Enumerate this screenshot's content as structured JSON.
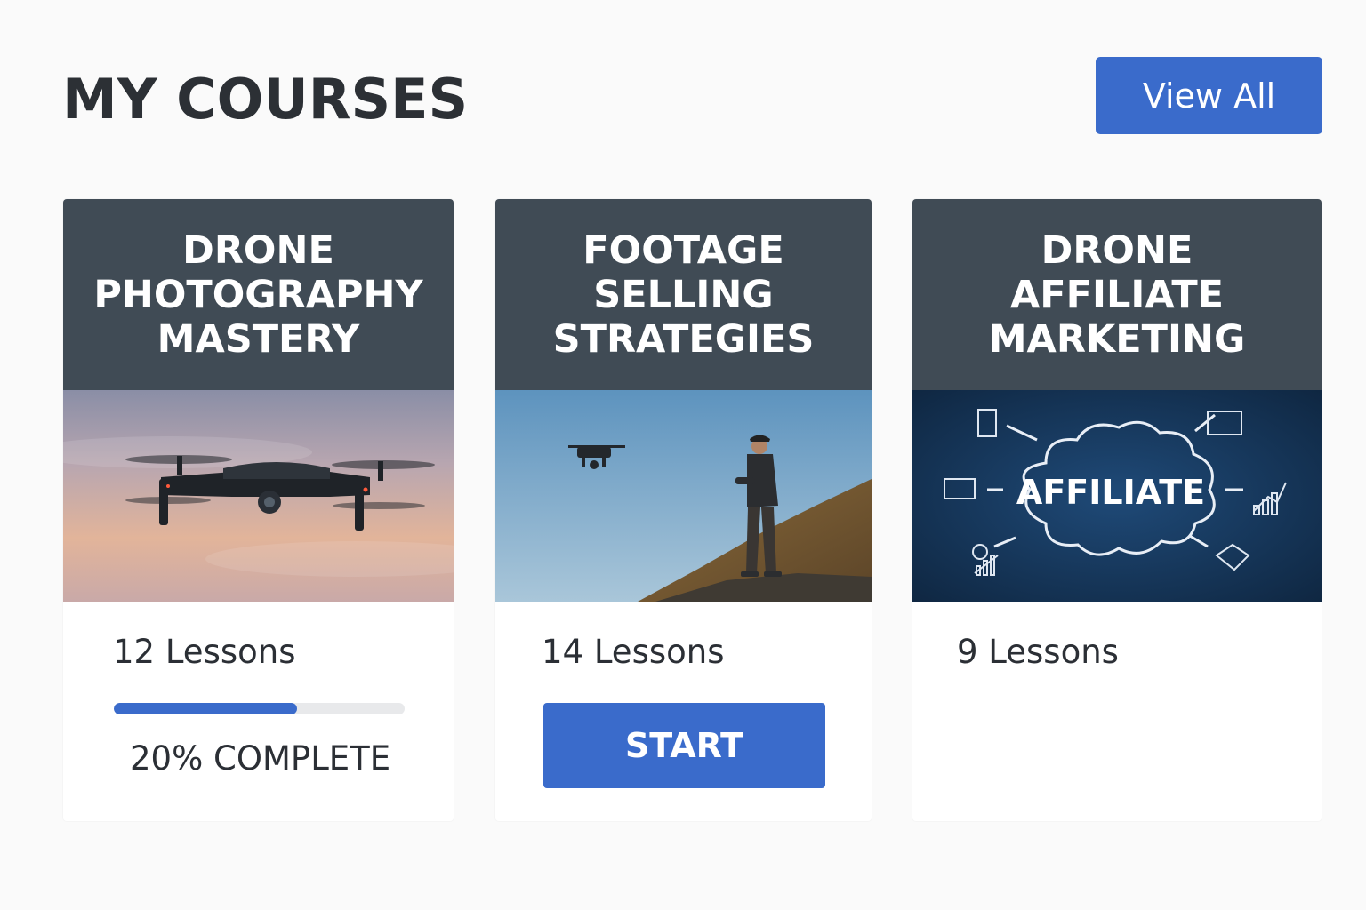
{
  "page": {
    "title": "MY COURSES",
    "view_all_label": "View All"
  },
  "courses": [
    {
      "title": "DRONE\nPHOTOGRAPHY\nMASTERY",
      "lessons": "12 Lessons",
      "progress_percent": 20,
      "progress_label": "20% COMPLETE",
      "image": "drone-in-sunset-sky"
    },
    {
      "title": "FOOTAGE\nSELLING\nSTRATEGIES",
      "lessons": "14 Lessons",
      "action_label": "START",
      "image": "pilot-flying-drone-on-hill"
    },
    {
      "title": "DRONE\nAFFILIATE\nMARKETING",
      "lessons": "9 Lessons",
      "image": "affiliate-cloud-diagram",
      "image_text": "AFFILIATE"
    }
  ],
  "colors": {
    "accent": "#3a6bcb",
    "card_header": "#404b55",
    "background": "#fafafa",
    "progress_track": "#e8e9eb"
  }
}
